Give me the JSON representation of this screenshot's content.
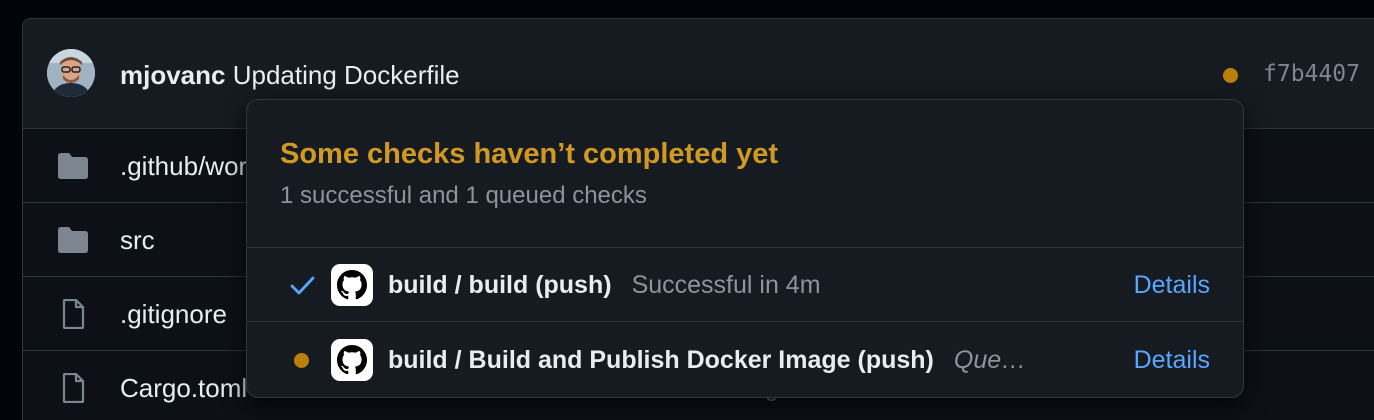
{
  "commit": {
    "author": "mjovanc",
    "message": "Updating Dockerfile",
    "sha": "f7b4407",
    "status_color": "#bb8009"
  },
  "files": [
    {
      "name": ".github/workflows",
      "type": "folder",
      "message": ""
    },
    {
      "name": "src",
      "type": "folder",
      "message": ""
    },
    {
      "name": ".gitignore",
      "type": "file",
      "message": ""
    },
    {
      "name": "Cargo.toml",
      "type": "file",
      "message": "g"
    }
  ],
  "checks_popover": {
    "title": "Some checks haven’t completed yet",
    "title_color": "#d29922",
    "summary": "1 successful and 1 queued checks",
    "checks": [
      {
        "name": "build / build (push)",
        "status": "success",
        "status_icon": "check-icon",
        "status_color": "#58a6ff",
        "description": "Successful in 4m",
        "link_label": "Details"
      },
      {
        "name": "build / Build and Publish Docker Image (push)",
        "status": "queued",
        "status_icon": "queued-dot-icon",
        "status_color": "#bb8009",
        "description": "Que…",
        "link_label": "Details"
      }
    ]
  }
}
